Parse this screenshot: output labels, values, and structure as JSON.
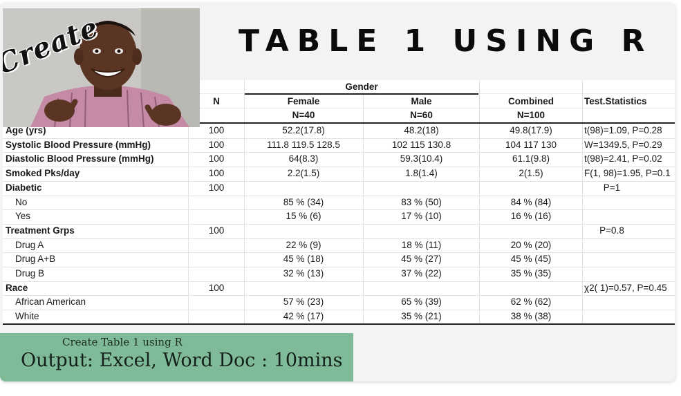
{
  "photo": {
    "overlay_text": "Create"
  },
  "title": "TABLE 1 USING R",
  "table": {
    "group_header": "Gender",
    "headers": {
      "n": "N",
      "female": "Female",
      "female_n": "N=40",
      "male": "Male",
      "male_n": "N=60",
      "combined": "Combined",
      "combined_n": "N=100",
      "test": "Test.Statistics"
    },
    "rows": [
      {
        "label": "Age (yrs)",
        "bold": true,
        "indent": false,
        "n": "100",
        "female": "52.2(17.8)",
        "male": "48.2(18)",
        "combined": "49.8(17.9)",
        "test": "t(98)=1.09, P=0.28"
      },
      {
        "label": "Systolic Blood Pressure (mmHg)",
        "bold": true,
        "indent": false,
        "n": "100",
        "female": "111.8 119.5    128.5",
        "male": "102 115    130.8",
        "combined": "104 117    130",
        "test": "W=1349.5, P=0.29"
      },
      {
        "label": "Diastolic Blood Pressure (mmHg)",
        "bold": true,
        "indent": false,
        "n": "100",
        "female": "64(8.3)",
        "male": "59.3(10.4)",
        "combined": "61.1(9.8)",
        "test": "t(98)=2.41, P=0.02"
      },
      {
        "label": "Smoked Pks/day",
        "bold": true,
        "indent": false,
        "n": "100",
        "female": "2.2(1.5)",
        "male": "1.8(1.4)",
        "combined": "2(1.5)",
        "test": "F(1, 98)=1.95, P=0.1"
      },
      {
        "label": "Diabetic",
        "bold": true,
        "indent": false,
        "n": "100",
        "female": "",
        "male": "",
        "combined": "",
        "test": "P=1"
      },
      {
        "label": "No",
        "bold": false,
        "indent": true,
        "n": "",
        "female": "85 % (34)",
        "male": "83 % (50)",
        "combined": "84 % (84)",
        "test": ""
      },
      {
        "label": "Yes",
        "bold": false,
        "indent": true,
        "n": "",
        "female": "15 % (6)",
        "male": "17 % (10)",
        "combined": "16 % (16)",
        "test": ""
      },
      {
        "label": "Treatment Grps",
        "bold": true,
        "indent": false,
        "n": "100",
        "female": "",
        "male": "",
        "combined": "",
        "test": "P=0.8"
      },
      {
        "label": "Drug A",
        "bold": false,
        "indent": true,
        "n": "",
        "female": "22 % (9)",
        "male": "18 % (11)",
        "combined": "20 % (20)",
        "test": ""
      },
      {
        "label": "Drug A+B",
        "bold": false,
        "indent": true,
        "n": "",
        "female": "45 % (18)",
        "male": "45 % (27)",
        "combined": "45 % (45)",
        "test": ""
      },
      {
        "label": "Drug B",
        "bold": false,
        "indent": true,
        "n": "",
        "female": "32 % (13)",
        "male": "37 % (22)",
        "combined": "35 % (35)",
        "test": ""
      },
      {
        "label": "Race",
        "bold": true,
        "indent": false,
        "n": "100",
        "female": "",
        "male": "",
        "combined": "",
        "test": "χ2( 1)=0.57, P=0.45"
      },
      {
        "label": "African American",
        "bold": false,
        "indent": true,
        "n": "",
        "female": "57 % (23)",
        "male": "65 % (39)",
        "combined": "62 % (62)",
        "test": ""
      },
      {
        "label": "White",
        "bold": false,
        "indent": true,
        "n": "",
        "female": "42 % (17)",
        "male": "35 % (21)",
        "combined": "38 % (38)",
        "test": ""
      }
    ]
  },
  "banner": {
    "subtitle": "Create Table 1 using R",
    "main": "Output: Excel, Word Doc : 10mins",
    "color": "#7fbb99"
  }
}
